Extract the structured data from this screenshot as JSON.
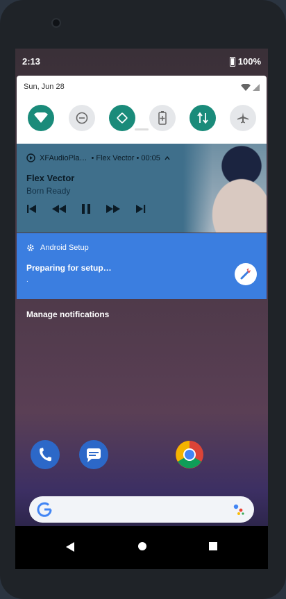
{
  "status_bar": {
    "time": "2:13",
    "battery": "100%"
  },
  "quick_settings": {
    "date": "Sun, Jun 28",
    "tiles": [
      "wifi",
      "do-not-disturb",
      "auto-rotate",
      "battery-saver",
      "mobile-data",
      "airplane-mode"
    ]
  },
  "media": {
    "app": "XFAudioPla…",
    "meta": "• Flex Vector • 00:05",
    "title": "Flex Vector",
    "subtitle": "Born Ready"
  },
  "notification": {
    "app": "Android Setup",
    "text": "Preparing for setup…",
    "detail": "."
  },
  "manage_label": "Manage notifications",
  "colors": {
    "tile_on": "#1a8b7a",
    "tile_off": "#e5e7ea",
    "media_bg": "#3f6f8b",
    "notif_bg": "#3b7ee0"
  }
}
